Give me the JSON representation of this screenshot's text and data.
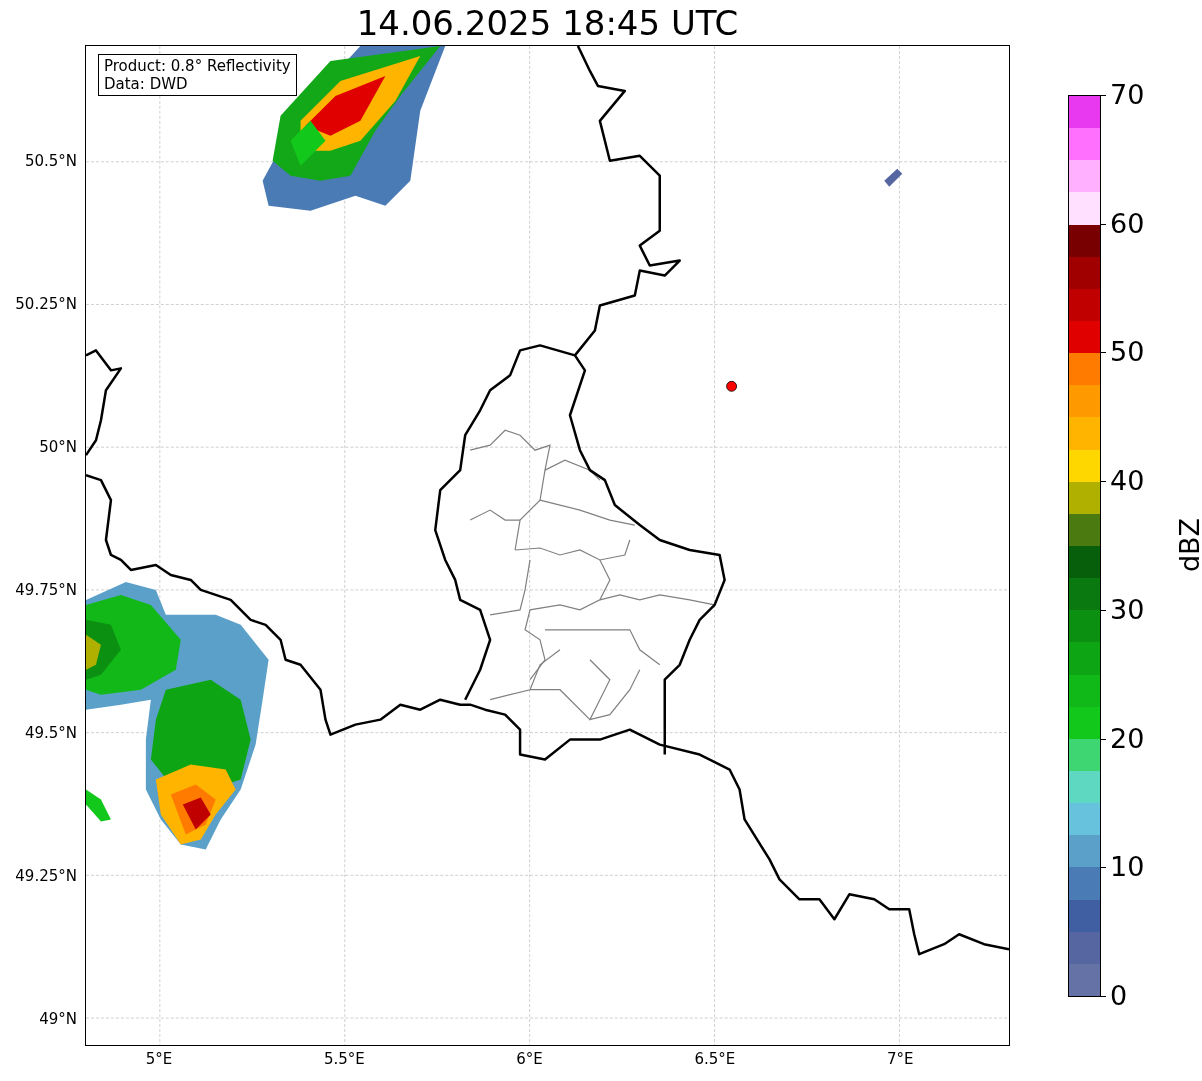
{
  "title": "14.06.2025 18:45 UTC",
  "annotation": [
    "Product: 0.8° Reflectivity",
    "Data: DWD"
  ],
  "map": {
    "lat_labels": [
      "50.5°N",
      "50.25°N",
      "50°N",
      "49.75°N",
      "49.5°N",
      "49.25°N",
      "49°N"
    ],
    "lon_labels": [
      "5°E",
      "5.5°E",
      "6°E",
      "6.5°E",
      "7°E"
    ]
  },
  "colorbar": {
    "label": "dBZ",
    "ticks": [
      "70",
      "60",
      "50",
      "40",
      "30",
      "20",
      "10",
      "0"
    ],
    "segments": [
      {
        "color": "#e838f0"
      },
      {
        "color": "#ff70ff"
      },
      {
        "color": "#ffb0ff"
      },
      {
        "color": "#ffe0ff"
      },
      {
        "color": "#780000"
      },
      {
        "color": "#a00000"
      },
      {
        "color": "#c00000"
      },
      {
        "color": "#e00000"
      },
      {
        "color": "#ff7b00"
      },
      {
        "color": "#ff9900"
      },
      {
        "color": "#ffb400"
      },
      {
        "color": "#ffd700"
      },
      {
        "color": "#b0b000"
      },
      {
        "color": "#4a7a10"
      },
      {
        "color": "#075f0c"
      },
      {
        "color": "#0a7a10"
      },
      {
        "color": "#0c9012"
      },
      {
        "color": "#0ea514"
      },
      {
        "color": "#10b818"
      },
      {
        "color": "#12c81a"
      },
      {
        "color": "#3dd672"
      },
      {
        "color": "#5fd8c2"
      },
      {
        "color": "#66c2dd"
      },
      {
        "color": "#5ba0c8"
      },
      {
        "color": "#4a7bb5"
      },
      {
        "color": "#405ea2"
      },
      {
        "color": "#5566a0"
      },
      {
        "color": "#6472a6"
      }
    ]
  }
}
